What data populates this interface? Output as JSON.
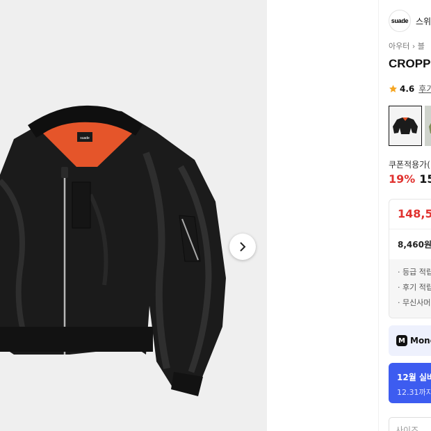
{
  "brand": {
    "logo_text": "suade",
    "name": "스위"
  },
  "breadcrumb": {
    "text": "아우터 › 블"
  },
  "product": {
    "title": "CROPPI"
  },
  "rating": {
    "value": "4.6",
    "reviews_label": "후기"
  },
  "pricing": {
    "coupon_label": "쿠폰적용가(",
    "discount_pct": "19%",
    "price_partial": "15",
    "box_price": "148,5",
    "points": "8,460원",
    "benefits": [
      "· 등급 적립",
      "· 후기 적립",
      "· 무신사머"
    ]
  },
  "money": {
    "icon": "M",
    "label": "Mone"
  },
  "promo": {
    "title": "12월 실버",
    "subtitle": "12.31까지 -"
  },
  "size_select": {
    "placeholder": "사이즈"
  },
  "colors": {
    "discount": "#e0322f",
    "promo": "#3d5cf0",
    "money_bg": "#eef1fd",
    "star": "#f5a623"
  }
}
